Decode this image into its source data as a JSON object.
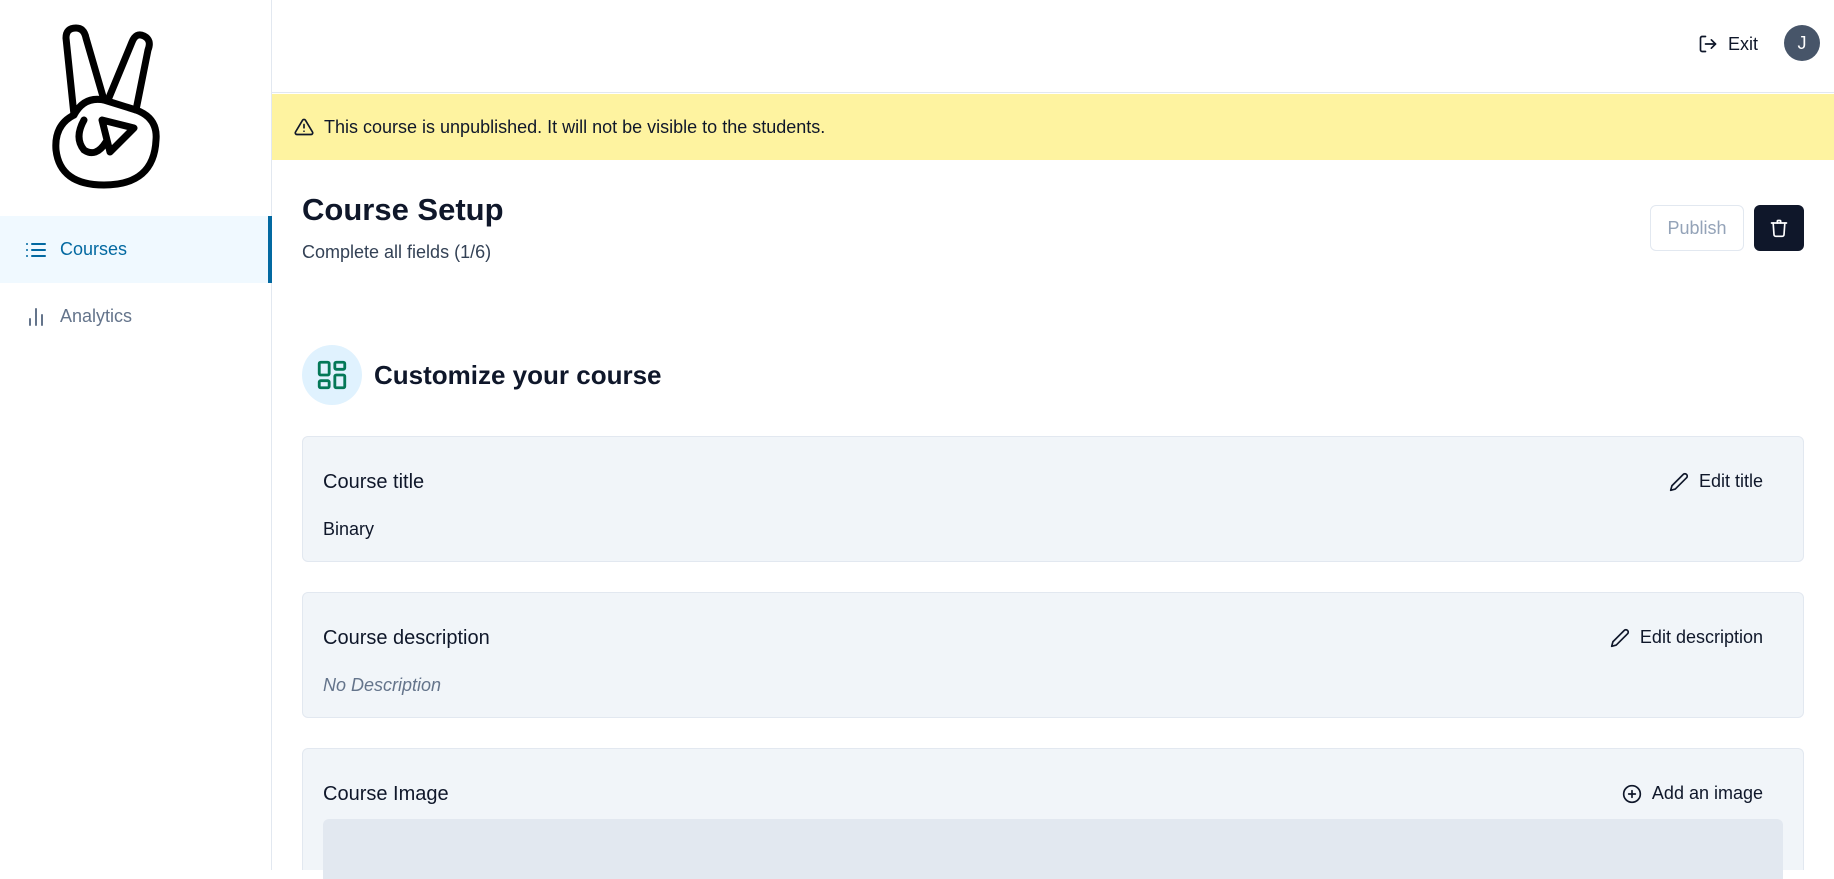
{
  "sidebar": {
    "items": [
      {
        "label": "Courses",
        "icon": "list-icon",
        "active": true
      },
      {
        "label": "Analytics",
        "icon": "bar-chart-icon",
        "active": false
      }
    ]
  },
  "topbar": {
    "exit_label": "Exit",
    "avatar_initial": "J"
  },
  "banner": {
    "text": "This course is unpublished. It will not be visible to the students."
  },
  "header": {
    "title": "Course Setup",
    "subtitle": "Complete all fields (1/6)",
    "publish_label": "Publish"
  },
  "section": {
    "title": "Customize your course"
  },
  "cards": {
    "title": {
      "label": "Course title",
      "action": "Edit title",
      "value": "Binary"
    },
    "description": {
      "label": "Course description",
      "action": "Edit description",
      "value": "No Description"
    },
    "image": {
      "label": "Course Image",
      "action": "Add an image"
    }
  },
  "colors": {
    "accent": "#0369a1",
    "banner": "#fef3a0",
    "primary_dark": "#0f172a"
  }
}
